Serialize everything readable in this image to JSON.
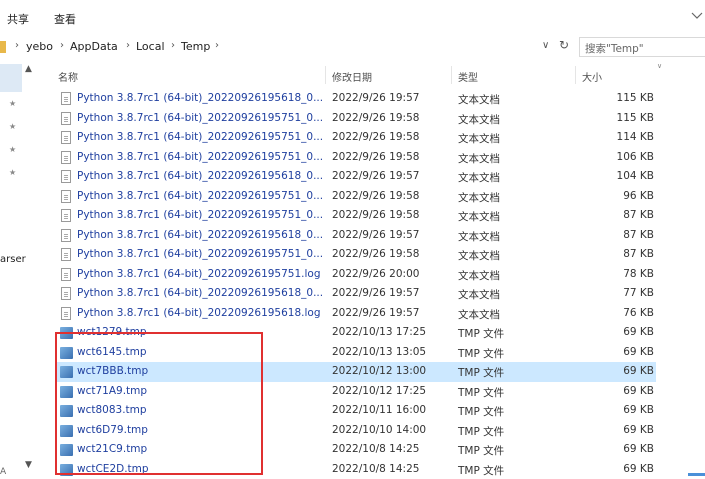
{
  "menu": {
    "share": "共享",
    "view": "查看"
  },
  "address": {
    "crumbs": [
      "yebo",
      "AppData",
      "Local",
      "Temp"
    ],
    "search_placeholder": "搜索\"Temp\""
  },
  "nav": {
    "partial_text": "arser",
    "bottom_text": "A"
  },
  "columns": {
    "name": "名称",
    "date": "修改日期",
    "type": "类型",
    "size": "大小"
  },
  "rows": [
    {
      "name": "Python 3.8.7rc1 (64-bit)_20220926195618_0...",
      "date": "2022/9/26 19:57",
      "type": "文本文档",
      "size": "115 KB",
      "icon": "text-file-icon"
    },
    {
      "name": "Python 3.8.7rc1 (64-bit)_20220926195751_0...",
      "date": "2022/9/26 19:58",
      "type": "文本文档",
      "size": "115 KB",
      "icon": "text-file-icon"
    },
    {
      "name": "Python 3.8.7rc1 (64-bit)_20220926195751_0...",
      "date": "2022/9/26 19:58",
      "type": "文本文档",
      "size": "114 KB",
      "icon": "text-file-icon"
    },
    {
      "name": "Python 3.8.7rc1 (64-bit)_20220926195751_0...",
      "date": "2022/9/26 19:58",
      "type": "文本文档",
      "size": "106 KB",
      "icon": "text-file-icon"
    },
    {
      "name": "Python 3.8.7rc1 (64-bit)_20220926195618_0...",
      "date": "2022/9/26 19:57",
      "type": "文本文档",
      "size": "104 KB",
      "icon": "text-file-icon"
    },
    {
      "name": "Python 3.8.7rc1 (64-bit)_20220926195751_0...",
      "date": "2022/9/26 19:58",
      "type": "文本文档",
      "size": "96 KB",
      "icon": "text-file-icon"
    },
    {
      "name": "Python 3.8.7rc1 (64-bit)_20220926195751_0...",
      "date": "2022/9/26 19:58",
      "type": "文本文档",
      "size": "87 KB",
      "icon": "text-file-icon"
    },
    {
      "name": "Python 3.8.7rc1 (64-bit)_20220926195618_0...",
      "date": "2022/9/26 19:57",
      "type": "文本文档",
      "size": "87 KB",
      "icon": "text-file-icon"
    },
    {
      "name": "Python 3.8.7rc1 (64-bit)_20220926195751_0...",
      "date": "2022/9/26 19:58",
      "type": "文本文档",
      "size": "87 KB",
      "icon": "text-file-icon"
    },
    {
      "name": "Python 3.8.7rc1 (64-bit)_20220926195751.log",
      "date": "2022/9/26 20:00",
      "type": "文本文档",
      "size": "78 KB",
      "icon": "text-file-icon"
    },
    {
      "name": "Python 3.8.7rc1 (64-bit)_20220926195618_0...",
      "date": "2022/9/26 19:57",
      "type": "文本文档",
      "size": "77 KB",
      "icon": "text-file-icon"
    },
    {
      "name": "Python 3.8.7rc1 (64-bit)_20220926195618.log",
      "date": "2022/9/26 19:57",
      "type": "文本文档",
      "size": "76 KB",
      "icon": "text-file-icon"
    },
    {
      "name": "wct1279.tmp",
      "date": "2022/10/13 17:25",
      "type": "TMP 文件",
      "size": "69 KB",
      "icon": "tmp-file-icon"
    },
    {
      "name": "wct6145.tmp",
      "date": "2022/10/13 13:05",
      "type": "TMP 文件",
      "size": "69 KB",
      "icon": "tmp-file-icon"
    },
    {
      "name": "wct7BBB.tmp",
      "date": "2022/10/12 13:00",
      "type": "TMP 文件",
      "size": "69 KB",
      "icon": "tmp-file-icon",
      "selected": true
    },
    {
      "name": "wct71A9.tmp",
      "date": "2022/10/12 17:25",
      "type": "TMP 文件",
      "size": "69 KB",
      "icon": "tmp-file-icon"
    },
    {
      "name": "wct8083.tmp",
      "date": "2022/10/11 16:00",
      "type": "TMP 文件",
      "size": "69 KB",
      "icon": "tmp-file-icon"
    },
    {
      "name": "wct6D79.tmp",
      "date": "2022/10/10 14:00",
      "type": "TMP 文件",
      "size": "69 KB",
      "icon": "tmp-file-icon"
    },
    {
      "name": "wct21C9.tmp",
      "date": "2022/10/8 14:25",
      "type": "TMP 文件",
      "size": "69 KB",
      "icon": "tmp-file-icon"
    },
    {
      "name": "wctCE2D.tmp",
      "date": "2022/10/8 14:25",
      "type": "TMP 文件",
      "size": "69 KB",
      "icon": "tmp-file-icon"
    }
  ],
  "colors": {
    "selection": "#cce8ff",
    "link": "#1f3f9f",
    "highlight_box": "#e03030",
    "folder": "#e8b84a"
  }
}
